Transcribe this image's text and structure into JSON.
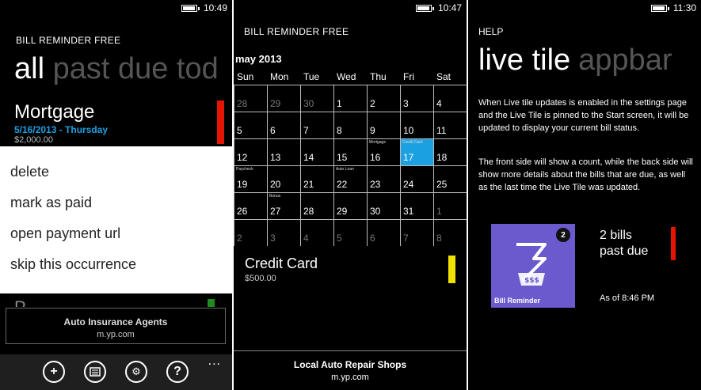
{
  "screen1": {
    "time": "10:49",
    "app_title": "BILL REMINDER FREE",
    "pivot": {
      "active": "all",
      "inactive": "past due tod"
    },
    "bill": {
      "name": "Mortgage",
      "date": "5/16/2013 - Thursday",
      "amount": "$2,000.00",
      "bar_color": "#e51400"
    },
    "context_menu": [
      "delete",
      "mark as paid",
      "open payment url",
      "skip this occurrence"
    ],
    "next_bill_initial": "P",
    "next_bar_color": "#1e8c1e",
    "ad": {
      "title": "Auto Insurance Agents",
      "url": "m.yp.com"
    },
    "appbar": {
      "add_icon": "add-icon",
      "calendar_icon": "calendar-icon",
      "settings_icon": "settings-icon",
      "help_icon": "help-icon",
      "more": "..."
    }
  },
  "screen2": {
    "time": "10:47",
    "app_title": "BILL REMINDER FREE",
    "month": "may 2013",
    "weekdays": [
      "Sun",
      "Mon",
      "Tue",
      "Wed",
      "Thu",
      "Fri",
      "Sat"
    ],
    "weeks": [
      [
        {
          "d": "28",
          "dim": true
        },
        {
          "d": "29",
          "dim": true
        },
        {
          "d": "30",
          "dim": true
        },
        {
          "d": "1"
        },
        {
          "d": "2"
        },
        {
          "d": "3"
        },
        {
          "d": "4"
        }
      ],
      [
        {
          "d": "5"
        },
        {
          "d": "6"
        },
        {
          "d": "7"
        },
        {
          "d": "8"
        },
        {
          "d": "9"
        },
        {
          "d": "10"
        },
        {
          "d": "11"
        }
      ],
      [
        {
          "d": "12"
        },
        {
          "d": "13"
        },
        {
          "d": "14"
        },
        {
          "d": "15"
        },
        {
          "d": "16",
          "tag": "Mortgage"
        },
        {
          "d": "17",
          "tag": "Credit Card",
          "sel": true
        },
        {
          "d": "18"
        }
      ],
      [
        {
          "d": "19",
          "tag": "Paycheck"
        },
        {
          "d": "20"
        },
        {
          "d": "21"
        },
        {
          "d": "22",
          "tag": "Auto Loan"
        },
        {
          "d": "23"
        },
        {
          "d": "24"
        },
        {
          "d": "25"
        }
      ],
      [
        {
          "d": "26"
        },
        {
          "d": "27",
          "tag": "Bonus"
        },
        {
          "d": "28"
        },
        {
          "d": "29"
        },
        {
          "d": "30"
        },
        {
          "d": "31"
        },
        {
          "d": "1",
          "dim": true
        }
      ],
      [
        {
          "d": "2",
          "dim": true
        },
        {
          "d": "3",
          "dim": true
        },
        {
          "d": "4",
          "dim": true
        },
        {
          "d": "5",
          "dim": true
        },
        {
          "d": "6",
          "dim": true
        },
        {
          "d": "7",
          "dim": true
        },
        {
          "d": "8",
          "dim": true
        }
      ]
    ],
    "selected_color": "#1ba1e2",
    "detail": {
      "name": "Credit Card",
      "amount": "$500.00",
      "bar_color": "#f0e100"
    },
    "ad": {
      "title": "Local Auto Repair Shops",
      "url": "m.yp.com"
    }
  },
  "screen3": {
    "time": "11:30",
    "help_title": "HELP",
    "pivot": {
      "active": "live tile",
      "inactive": "appbar"
    },
    "para1": "When Live tile updates is enabled in the settings page and the Live Tile is pinned to the Start screen, it will be updated to display your current bill status.",
    "para2": "The front side will show a count, while the back side will show more details about the bills that are due, as well as the last time the Live Tile was updated.",
    "tile": {
      "badge": "2",
      "label": "Bill Reminder",
      "color": "#6a5acd",
      "icon": "bill-receipt-icon"
    },
    "count_line1": "2 bills",
    "count_line2": "past due",
    "as_of": "As of 8:46 PM",
    "bar_color": "#e51400"
  }
}
